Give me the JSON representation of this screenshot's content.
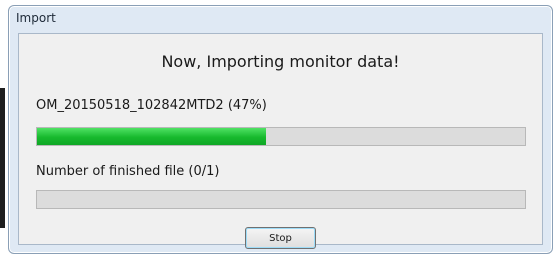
{
  "window": {
    "title": "Import"
  },
  "dialog": {
    "heading": "Now, Importing monitor data!",
    "current_file": "OM_20150518_102842MTD2 (47%)",
    "current_progress": 0.47,
    "files_label": "Number of finished file (0/1)",
    "files_progress": 0.0,
    "stop_label": "Stop"
  },
  "colors": {
    "progress_fill": "#17b92d",
    "progress_track": "#dcdcdc"
  }
}
